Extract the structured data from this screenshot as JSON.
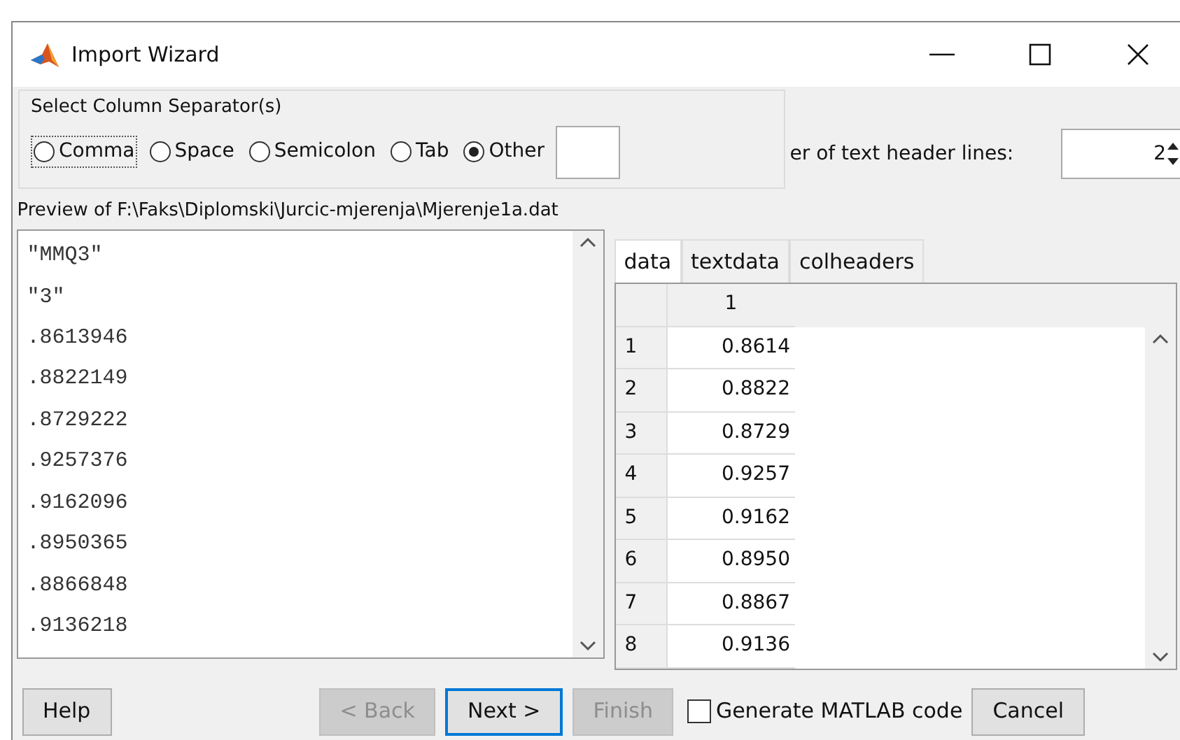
{
  "window": {
    "title": "Import Wizard"
  },
  "separator_group": {
    "title": "Select Column Separator(s)",
    "options": [
      {
        "label": "Comma",
        "selected": false,
        "focused": true
      },
      {
        "label": "Space",
        "selected": false,
        "focused": false
      },
      {
        "label": "Semicolon",
        "selected": false,
        "focused": false
      },
      {
        "label": "Tab",
        "selected": false,
        "focused": false
      },
      {
        "label": "Other",
        "selected": true,
        "focused": false
      }
    ]
  },
  "header_lines": {
    "label": "er of text header lines:",
    "value": "2"
  },
  "preview": {
    "label": "Preview of F:\\Faks\\Diplomski\\Jurcic-mjerenja\\Mjerenje1a.dat",
    "lines": [
      "\"MMQ3\"",
      "\"3\"",
      ".8613946",
      ".8822149",
      ".8729222",
      ".9257376",
      ".9162096",
      ".8950365",
      ".8866848",
      ".9136218"
    ]
  },
  "tabs": [
    {
      "label": "data",
      "selected": true
    },
    {
      "label": "textdata",
      "selected": false
    },
    {
      "label": "colheaders",
      "selected": false
    }
  ],
  "table": {
    "columns": [
      "1"
    ],
    "rows": [
      {
        "index": "1",
        "value": "0.8614"
      },
      {
        "index": "2",
        "value": "0.8822"
      },
      {
        "index": "3",
        "value": "0.8729"
      },
      {
        "index": "4",
        "value": "0.9257"
      },
      {
        "index": "5",
        "value": "0.9162"
      },
      {
        "index": "6",
        "value": "0.8950"
      },
      {
        "index": "7",
        "value": "0.8867"
      },
      {
        "index": "8",
        "value": "0.9136"
      }
    ]
  },
  "buttons": [
    {
      "label": "Help",
      "disabled": false,
      "default": false
    },
    {
      "label": "< Back",
      "disabled": true,
      "default": false
    },
    {
      "label": "Next >",
      "disabled": false,
      "default": true
    },
    {
      "label": "Finish",
      "disabled": true,
      "default": false
    }
  ],
  "generate_code": {
    "label": "Generate MATLAB code",
    "checked": false
  },
  "cancel": {
    "label": "Cancel",
    "disabled": false,
    "default": false
  }
}
